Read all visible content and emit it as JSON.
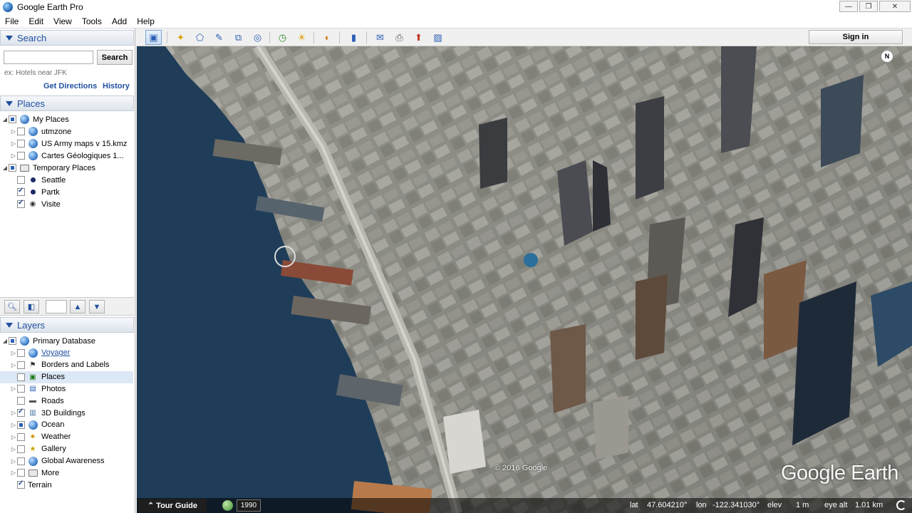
{
  "window": {
    "title": "Google Earth Pro",
    "controls": [
      "—",
      "❐",
      "✕"
    ]
  },
  "menu": [
    "File",
    "Edit",
    "View",
    "Tools",
    "Add",
    "Help"
  ],
  "search": {
    "header": "Search",
    "input_value": "",
    "button": "Search",
    "hint": "ex: Hotels near JFK",
    "get_directions": "Get Directions",
    "history": "History"
  },
  "places": {
    "header": "Places",
    "items": [
      {
        "label": "My Places",
        "checked": "partial",
        "icon": "globe-icon"
      },
      {
        "label": "utmzone",
        "checked": "off",
        "icon": "globe-icon"
      },
      {
        "label": "US Army maps v 15.kmz",
        "checked": "off",
        "icon": "globe-icon"
      },
      {
        "label": "Cartes Géologiques  1...",
        "checked": "off",
        "icon": "globe-icon"
      },
      {
        "label": "Temporary Places",
        "checked": "partial",
        "icon": "folder-icon"
      },
      {
        "label": "Seattle",
        "checked": "off",
        "icon": "placemark-icon"
      },
      {
        "label": "Partk",
        "checked": "on",
        "icon": "placemark-icon"
      },
      {
        "label": "Visite",
        "checked": "on",
        "icon": "tour-icon"
      }
    ]
  },
  "layers": {
    "header": "Layers",
    "items": [
      {
        "label": "Primary Database",
        "checked": "partial",
        "icon": "database-icon"
      },
      {
        "label": "Voyager",
        "checked": "off",
        "icon": "globe-icon"
      },
      {
        "label": "Borders and Labels",
        "checked": "off",
        "icon": "flag-icon"
      },
      {
        "label": "Places",
        "checked": "off",
        "icon": "places-icon"
      },
      {
        "label": "Photos",
        "checked": "off",
        "icon": "photo-icon"
      },
      {
        "label": "Roads",
        "checked": "off",
        "icon": "road-icon"
      },
      {
        "label": "3D Buildings",
        "checked": "on",
        "icon": "buildings-icon"
      },
      {
        "label": "Ocean",
        "checked": "partial",
        "icon": "globe-icon"
      },
      {
        "label": "Weather",
        "checked": "off",
        "icon": "sun-icon"
      },
      {
        "label": "Gallery",
        "checked": "off",
        "icon": "star-icon"
      },
      {
        "label": "Global Awareness",
        "checked": "off",
        "icon": "globe-icon"
      },
      {
        "label": "More",
        "checked": "off",
        "icon": "folder-icon"
      },
      {
        "label": "Terrain",
        "checked": "on",
        "icon": ""
      }
    ]
  },
  "toolbar": {
    "sign_in": "Sign in"
  },
  "map": {
    "copyright": "© 2016 Google",
    "logo": "Google Earth",
    "compass": "N"
  },
  "status": {
    "tour_guide": "Tour Guide",
    "year": "1990",
    "lat_label": "lat",
    "lat": "47.604210°",
    "lon_label": "lon",
    "lon": "-122.341030°",
    "elev_label": "elev",
    "elev": "1 m",
    "eye_alt_label": "eye alt",
    "eye_alt": "1.01 km"
  },
  "colors": {
    "header_text": "#1f4f9f",
    "water": "#1f3d58",
    "link": "#1f4f9f"
  }
}
